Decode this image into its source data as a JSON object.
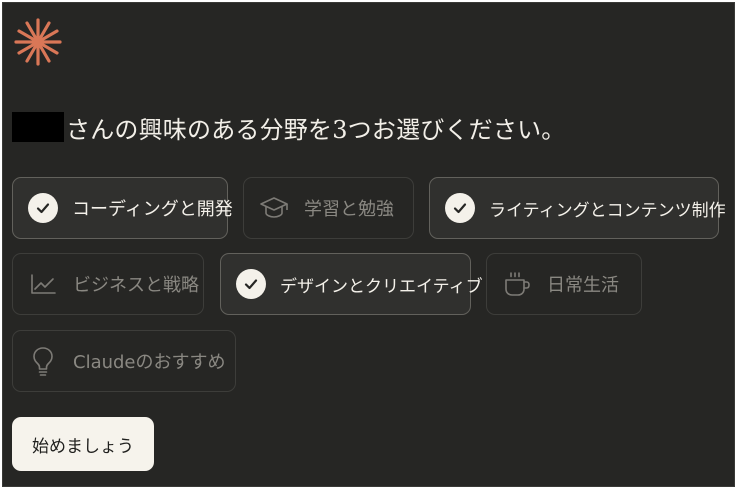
{
  "heading": {
    "redacted_name": "",
    "text": "さんの興味のある分野を3つお選びください。"
  },
  "topics": [
    {
      "label": "コーディングと開発",
      "selected": true,
      "icon": "check-icon"
    },
    {
      "label": "学習と勉強",
      "selected": false,
      "icon": "graduation-cap-icon"
    },
    {
      "label": "ライティングとコンテンツ制作",
      "selected": true,
      "icon": "check-icon"
    },
    {
      "label": "ビジネスと戦略",
      "selected": false,
      "icon": "line-chart-icon"
    },
    {
      "label": "デザインとクリエイティブ",
      "selected": true,
      "icon": "check-icon"
    },
    {
      "label": "日常生活",
      "selected": false,
      "icon": "coffee-cup-icon"
    },
    {
      "label": "Claudeのおすすめ",
      "selected": false,
      "icon": "lightbulb-icon"
    }
  ],
  "start_button": {
    "label": "始めましょう"
  },
  "colors": {
    "background": "#262624",
    "logo": "#d97757",
    "chip_selected_bg": "#30302e",
    "chip_selected_border": "#62615c",
    "chip_unselected_border": "#3d3d3a",
    "text_primary": "#f4f1ea",
    "text_muted": "#8a8882",
    "button_bg": "#f6f3ec"
  }
}
